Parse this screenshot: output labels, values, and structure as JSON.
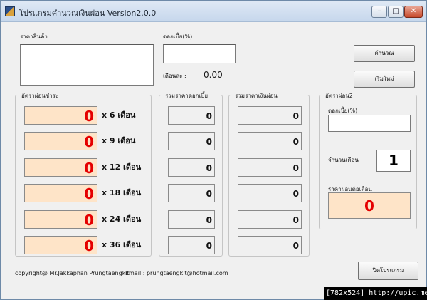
{
  "window": {
    "title": "โปรแกรมคำนวณเงินผ่อน Version2.0.0",
    "min_symbol": "–",
    "max_symbol": "□",
    "close_symbol": "✕"
  },
  "top": {
    "price_label": "ราคาสินค้า",
    "interest_label": "ดอกเบี้ย(%)",
    "price_value": "",
    "interest_value": "",
    "monthly_label": "เดือนละ :",
    "monthly_value": "0.00",
    "calc_button": "คำนวณ",
    "new_button": "เริ่มใหม่"
  },
  "rates_group": {
    "title": "อัตราผ่อนชำระ",
    "rows": [
      {
        "value": "0",
        "months": "x  6 เดือน"
      },
      {
        "value": "0",
        "months": "x  9 เดือน"
      },
      {
        "value": "0",
        "months": "x 12 เดือน"
      },
      {
        "value": "0",
        "months": "x 18 เดือน"
      },
      {
        "value": "0",
        "months": "x 24 เดือน"
      },
      {
        "value": "0",
        "months": "x 36 เดือน"
      }
    ]
  },
  "interest_group": {
    "title": "รวมราคาดอกเบี้ย",
    "values": [
      "0",
      "0",
      "0",
      "0",
      "0",
      "0"
    ]
  },
  "total_group": {
    "title": "รวมราคาเงินผ่อน",
    "values": [
      "0",
      "0",
      "0",
      "0",
      "0",
      "0"
    ]
  },
  "rate2_group": {
    "title": "อัตราผ่อน2",
    "interest_label": "ดอกเบี้ย(%)",
    "interest_value": "",
    "months_label": "จำนวนเดือน",
    "months_value": "1",
    "per_month_label": "ราคาผ่อนต่อเดือน",
    "per_month_value": "0"
  },
  "footer": {
    "copyright": "copyright@ Mr.Jakkaphan Prungtaengkit",
    "email": "Email : prungtaengkit@hotmail.com",
    "close_button": "ปิดโปรแกรม"
  },
  "watermark": "[782x524] http://upic.me/"
}
